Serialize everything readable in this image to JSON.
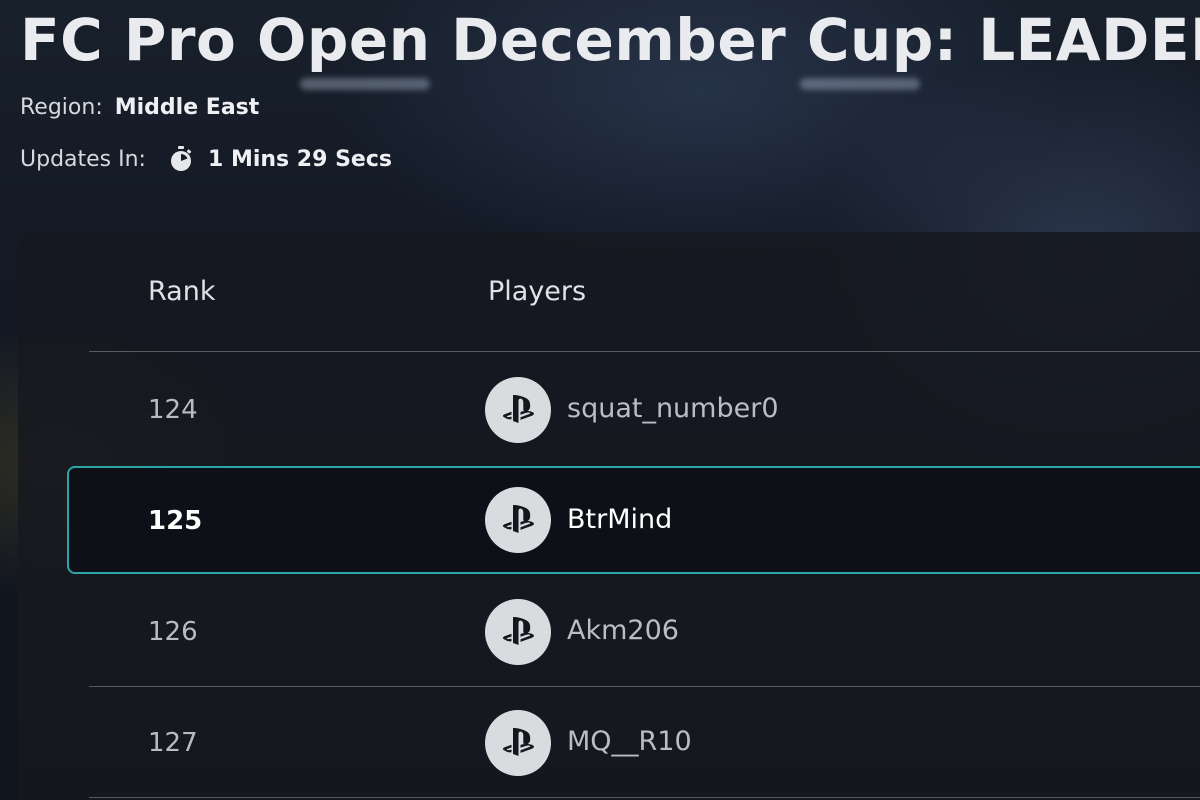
{
  "header": {
    "title": "FC Pro Open December Cup:  LEADERBO",
    "region_label": "Region:",
    "region_value": "Middle East",
    "updates_label": "Updates In:",
    "updates_icon": "stopwatch-icon",
    "updates_value": "1 Mins 29 Secs"
  },
  "table": {
    "columns": [
      "Rank",
      "Players"
    ],
    "rows": [
      {
        "rank": "124",
        "platform_icon": "playstation-icon",
        "player": "squat_number0",
        "selected": false
      },
      {
        "rank": "125",
        "platform_icon": "playstation-icon",
        "player": "BtrMind",
        "selected": true
      },
      {
        "rank": "126",
        "platform_icon": "playstation-icon",
        "player": "Akm206",
        "selected": false
      },
      {
        "rank": "127",
        "platform_icon": "playstation-icon",
        "player": "MQ__R10",
        "selected": false
      }
    ]
  },
  "colors": {
    "accent_selected_border": "#2aa6a6",
    "panel_background": "#16181f",
    "avatar_background": "#d9dbdf"
  }
}
